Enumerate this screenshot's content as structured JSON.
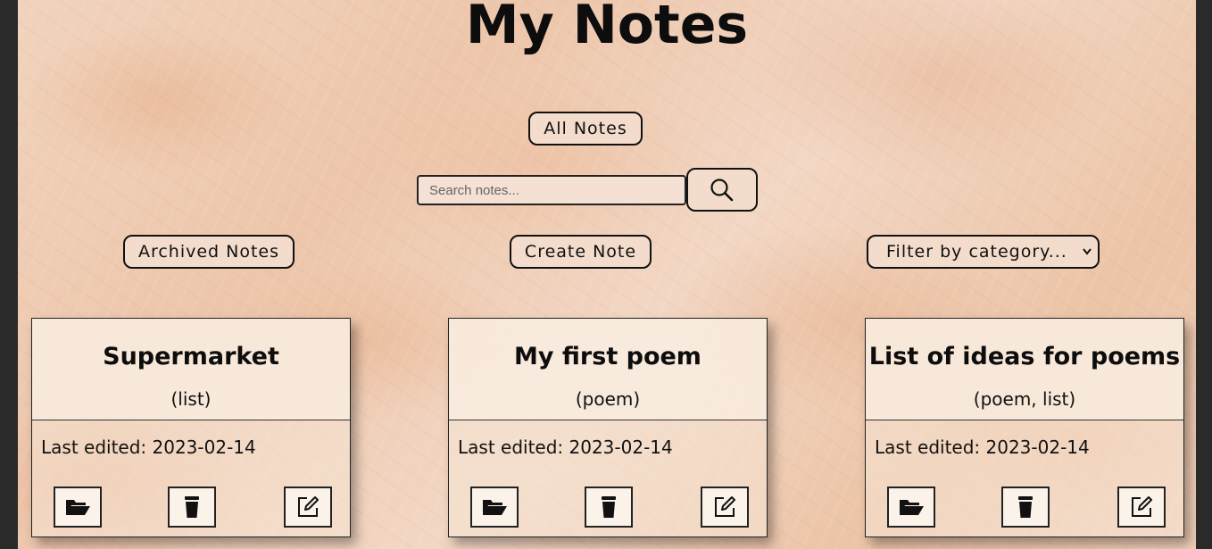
{
  "header": {
    "title": "My Notes"
  },
  "nav": {
    "all_notes_label": "All Notes",
    "archived_label": "Archived Notes",
    "create_label": "Create Note"
  },
  "search": {
    "placeholder": "Search notes...",
    "value": ""
  },
  "filter": {
    "selected": "Filter by category..."
  },
  "notes": [
    {
      "title": "Supermarket",
      "categories": "(list)",
      "last_edited": "Last edited: 2023-02-14"
    },
    {
      "title": "My first poem",
      "categories": "(poem)",
      "last_edited": "Last edited: 2023-02-14"
    },
    {
      "title": "List of ideas for poems",
      "categories": "(poem, list)",
      "last_edited": "Last edited: 2023-02-14"
    }
  ],
  "icons": {
    "search": "search-icon",
    "archive": "folder-icon",
    "delete": "trash-icon",
    "edit": "edit-icon"
  },
  "colors": {
    "background": "#f0cfb8",
    "button": "#f3dccb",
    "text": "#111111"
  }
}
